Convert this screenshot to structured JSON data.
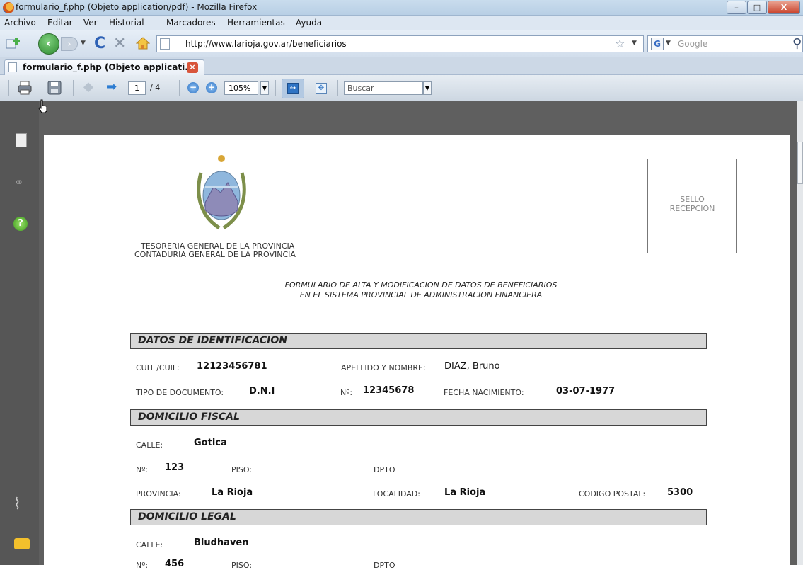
{
  "window": {
    "title": "formulario_f.php (Objeto application/pdf) - Mozilla Firefox",
    "min_label": "–",
    "max_label": "□",
    "close_label": "X"
  },
  "menu": {
    "items": [
      "Archivo",
      "Editar",
      "Ver",
      "Historial",
      "Marcadores",
      "Herramientas",
      "Ayuda"
    ]
  },
  "navigation": {
    "url": "http://www.larioja.gov.ar/beneficiarios",
    "search_placeholder": "Google",
    "search_engine_glyph": "G"
  },
  "tab": {
    "label": "formulario_f.php (Objeto applicati..."
  },
  "pdf_toolbar": {
    "page_current": "1",
    "page_total": "/ 4",
    "zoom": "105%",
    "find_placeholder": "Buscar"
  },
  "document": {
    "org_line1": "TESORERIA GENERAL DE LA PROVINCIA",
    "org_line2": "CONTADURIA GENERAL DE LA PROVINCIA",
    "stamp_line1": "SELLO",
    "stamp_line2": "RECEPCION",
    "form_title_line1": "FORMULARIO DE ALTA Y MODIFICACION DE DATOS DE BENEFICIARIOS",
    "form_title_line2": "EN EL SISTEMA PROVINCIAL DE ADMINISTRACION FINANCIERA",
    "identification": {
      "section_title": "DATOS DE IDENTIFICACION",
      "cuit_label": "CUIT /CUIL:",
      "cuit_value": "12123456781",
      "name_label": "APELLIDO Y NOMBRE:",
      "name_value": "DIAZ, Bruno",
      "doc_type_label": "TIPO DE DOCUMENTO:",
      "doc_type_value": "D.N.I",
      "doc_number_label": "Nº:",
      "doc_number_value": "12345678",
      "birth_label": "FECHA NACIMIENTO:",
      "birth_value": "03-07-1977"
    },
    "fiscal_address": {
      "section_title": "DOMICILIO FISCAL",
      "street_label": "CALLE:",
      "street_value": "Gotica",
      "number_label": "Nº:",
      "number_value": "123",
      "floor_label": "PISO:",
      "apt_label": "DPTO",
      "province_label": "PROVINCIA:",
      "province_value": "La Rioja",
      "locality_label": "LOCALIDAD:",
      "locality_value": "La Rioja",
      "postal_label": "CODIGO POSTAL:",
      "postal_value": "5300"
    },
    "legal_address": {
      "section_title": "DOMICILIO LEGAL",
      "street_label": "CALLE:",
      "street_value": "Bludhaven",
      "number_label": "Nº:",
      "number_value": "456",
      "floor_label": "PISO:",
      "apt_label": "DPTO"
    }
  }
}
